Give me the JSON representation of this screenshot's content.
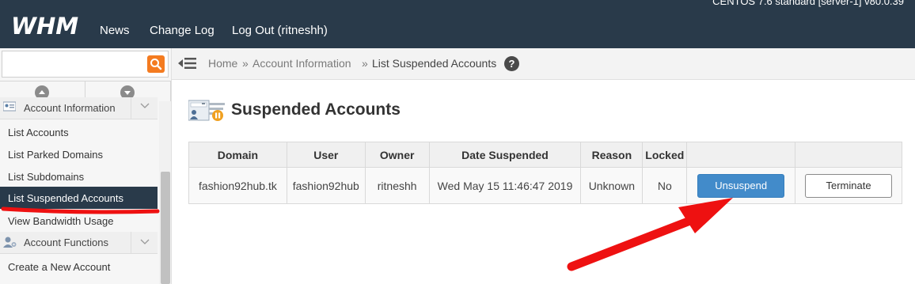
{
  "header": {
    "logo_text": "WHM",
    "nav": [
      "News",
      "Change Log",
      "Log Out (ritneshh)"
    ],
    "server_info": "CENTOS 7.6 standard [server-1]   v80.0.39"
  },
  "sidebar": {
    "search_placeholder": "",
    "sections": [
      {
        "label": "Account Information",
        "items": [
          "List Accounts",
          "List Parked Domains",
          "List Subdomains",
          "List Suspended Accounts",
          "View Bandwidth Usage"
        ]
      },
      {
        "label": "Account Functions",
        "items": [
          "Create a New Account"
        ]
      }
    ],
    "active_item": "List Suspended Accounts"
  },
  "breadcrumb": {
    "items": [
      "Home",
      "Account Information",
      "List Suspended Accounts"
    ],
    "separator": "»"
  },
  "page": {
    "title": "Suspended Accounts"
  },
  "table": {
    "headers": [
      "Domain",
      "User",
      "Owner",
      "Date Suspended",
      "Reason",
      "Locked",
      "",
      ""
    ],
    "rows": [
      {
        "domain": "fashion92hub.tk",
        "user": "fashion92hub",
        "owner": "ritneshh",
        "date_suspended": "Wed May 15 11:46:47 2019",
        "reason": "Unknown",
        "locked": "No",
        "unsuspend_label": "Unsuspend",
        "terminate_label": "Terminate"
      }
    ]
  },
  "colors": {
    "header_bg": "#293a4a",
    "accent_orange": "#f47b20",
    "primary_blue": "#428bca",
    "annotation_red": "#ee1111"
  }
}
